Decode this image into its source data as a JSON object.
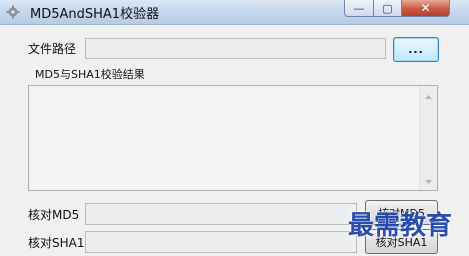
{
  "window": {
    "title": "MD5AndSHA1校验器",
    "controls": {
      "minimize": "—",
      "maximize": "▢",
      "close": "✕"
    }
  },
  "file_path": {
    "label": "文件路径",
    "value": "",
    "browse_label": "..."
  },
  "results": {
    "group_label": "MD5与SHA1校验结果",
    "text": ""
  },
  "md5": {
    "label": "核对MD5",
    "value": "",
    "button_label": "核对MD5"
  },
  "sha1": {
    "label": "核对SHA1",
    "value": "",
    "button_label": "核对SHA1"
  },
  "watermark": {
    "text": "最需教育"
  },
  "colors": {
    "title_gradient_top": "#dbe7f5",
    "close_button": "#c85a41",
    "watermark": "#2246a8"
  }
}
